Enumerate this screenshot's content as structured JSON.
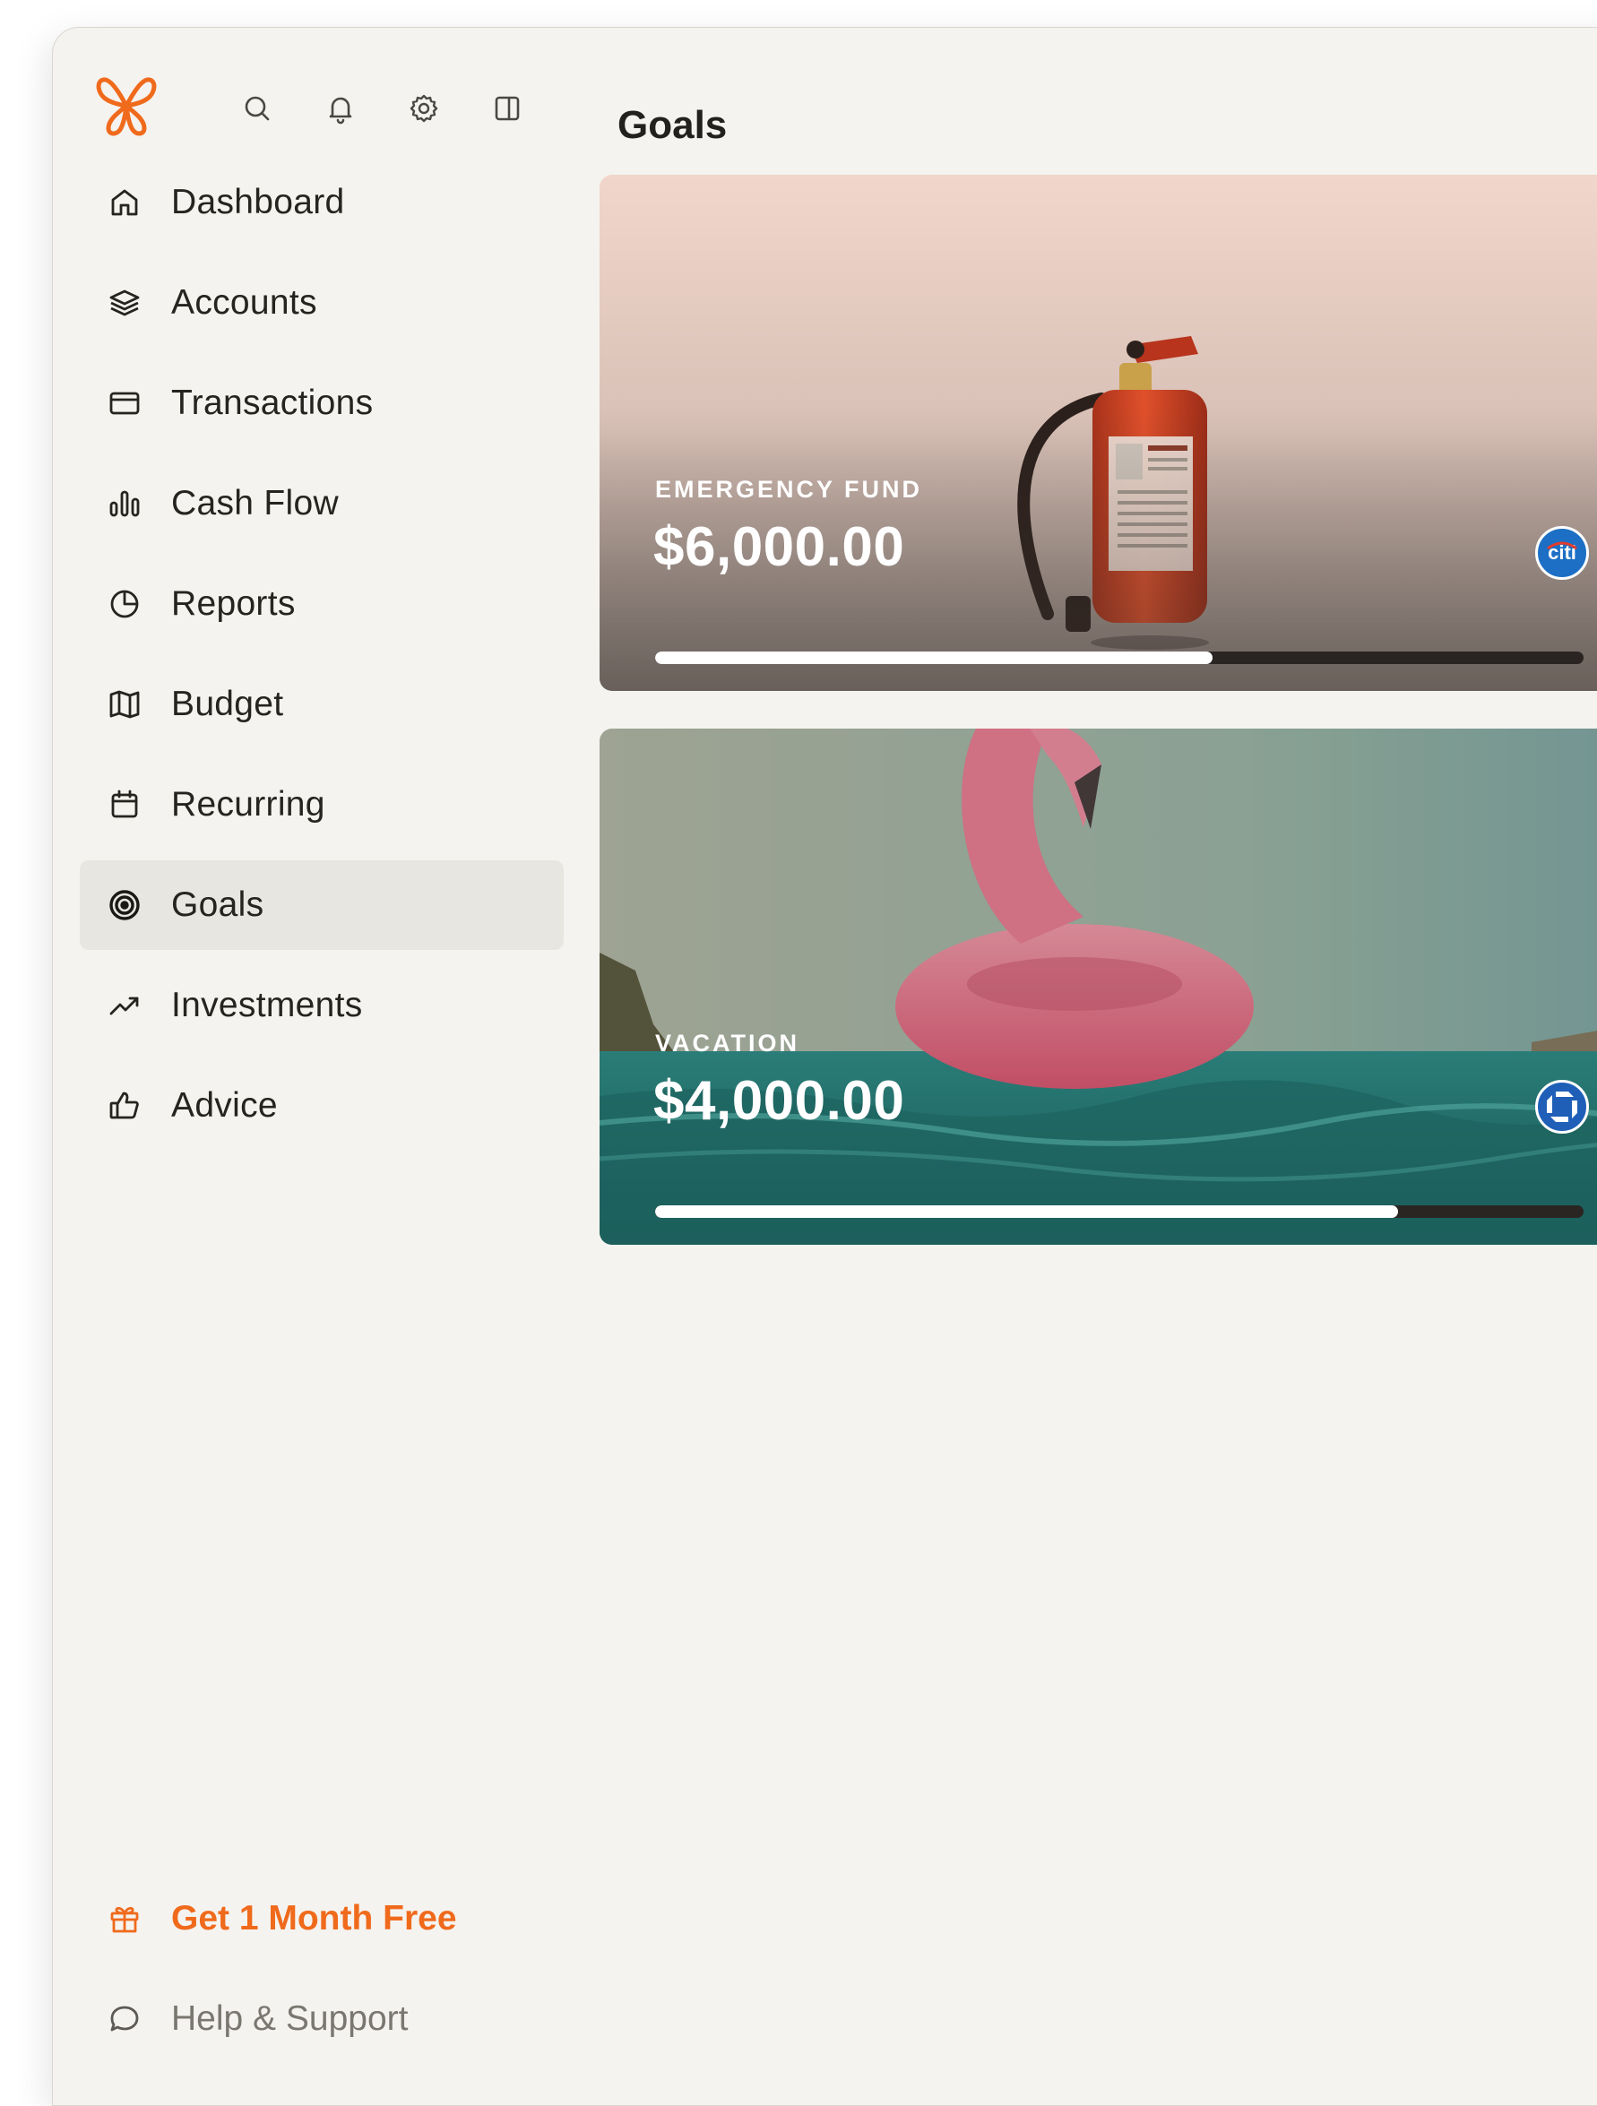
{
  "header": {
    "title": "Goals"
  },
  "icons": {
    "logo": "butterfly-logo",
    "top": [
      "search-icon",
      "bell-icon",
      "gear-icon",
      "sidebar-toggle-icon"
    ]
  },
  "sidebar": {
    "items": [
      {
        "label": "Dashboard",
        "icon": "home-icon",
        "active": false
      },
      {
        "label": "Accounts",
        "icon": "layers-icon",
        "active": false
      },
      {
        "label": "Transactions",
        "icon": "credit-card-icon",
        "active": false
      },
      {
        "label": "Cash Flow",
        "icon": "bar-chart-icon",
        "active": false
      },
      {
        "label": "Reports",
        "icon": "pie-chart-icon",
        "active": false
      },
      {
        "label": "Budget",
        "icon": "map-icon",
        "active": false
      },
      {
        "label": "Recurring",
        "icon": "calendar-icon",
        "active": false
      },
      {
        "label": "Goals",
        "icon": "target-icon",
        "active": true
      },
      {
        "label": "Investments",
        "icon": "trending-up-icon",
        "active": false
      },
      {
        "label": "Advice",
        "icon": "thumbs-up-icon",
        "active": false
      }
    ],
    "promo": {
      "label": "Get 1 Month Free",
      "icon": "gift-icon"
    },
    "help": {
      "label": "Help & Support",
      "icon": "chat-bubble-icon"
    }
  },
  "goals": [
    {
      "name": "EMERGENCY FUND",
      "amount": "$6,000.00",
      "progress": 0.6,
      "bank": "citi",
      "image": "fire-extinguisher"
    },
    {
      "name": "VACATION",
      "amount": "$4,000.00",
      "progress": 0.8,
      "bank": "chase",
      "image": "flamingo-float"
    }
  ],
  "colors": {
    "accent": "#f06a1c",
    "background": "#f5f3ef",
    "active_bg": "#e8e6e1",
    "citi": "#1c6fc4",
    "chase": "#1f5fb8"
  }
}
